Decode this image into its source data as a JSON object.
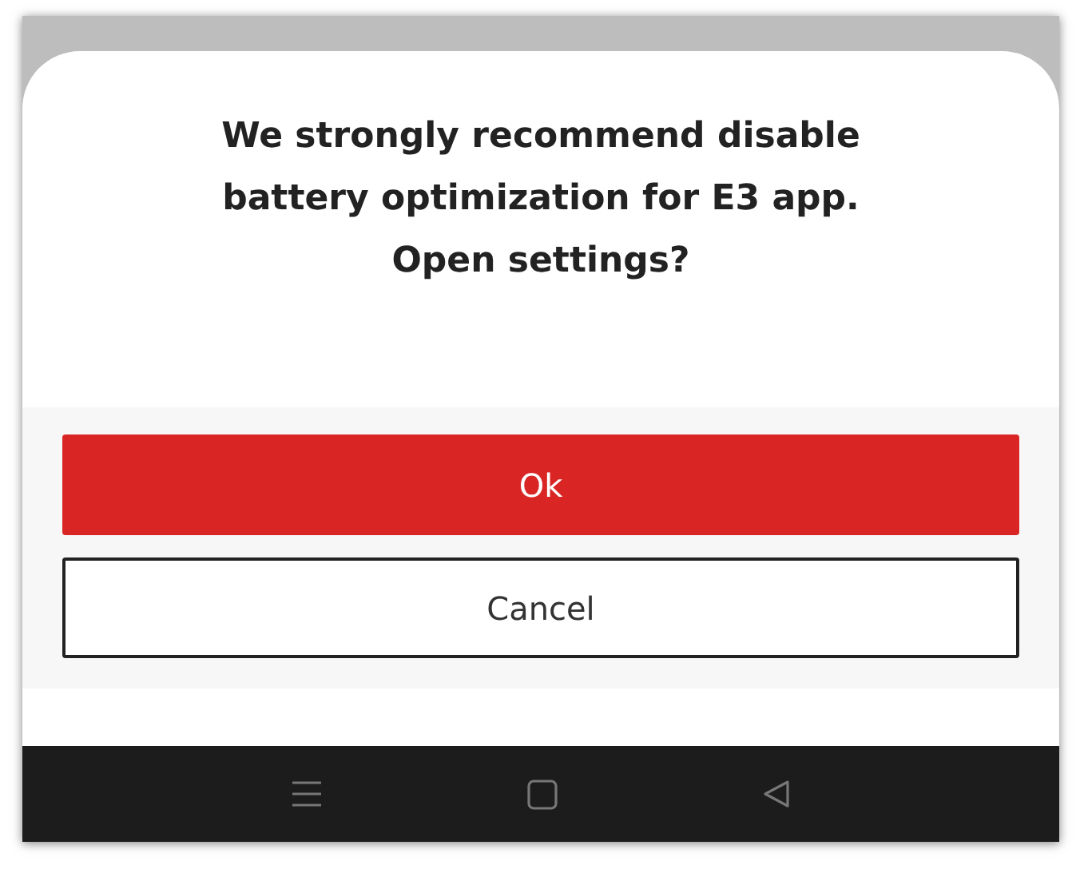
{
  "dialog": {
    "message": "We strongly recommend disable battery optimization for E3 app. Open settings?",
    "buttons": [
      {
        "label": "Ok",
        "kind": "primary"
      },
      {
        "label": "Cancel",
        "kind": "secondary"
      }
    ]
  }
}
